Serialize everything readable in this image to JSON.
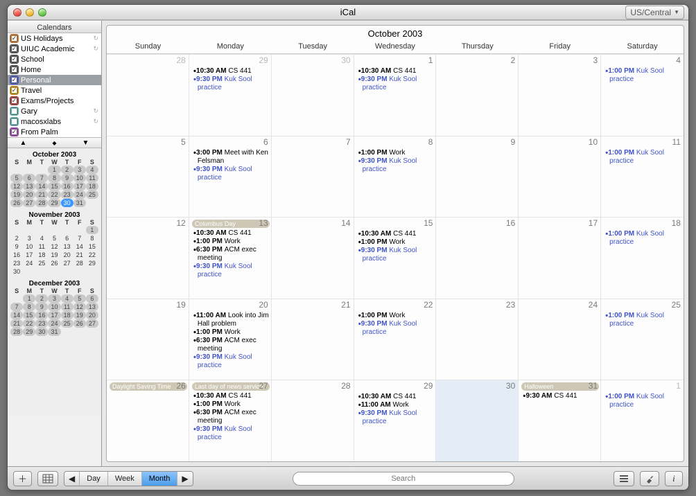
{
  "window": {
    "title": "iCal",
    "timezone": "US/Central"
  },
  "sidebar": {
    "header": "Calendars",
    "items": [
      {
        "label": "US Holidays",
        "color": "#d97a2a",
        "checked": true,
        "shared": true
      },
      {
        "label": "UIUC Academic",
        "color": "#404040",
        "checked": true,
        "shared": true
      },
      {
        "label": "School",
        "color": "#404040",
        "checked": true,
        "shared": false
      },
      {
        "label": "Home",
        "color": "#404040",
        "checked": true,
        "shared": false
      },
      {
        "label": "Personal",
        "color": "#4053c8",
        "checked": true,
        "shared": false,
        "selected": true
      },
      {
        "label": "Travel",
        "color": "#e2a100",
        "checked": true,
        "shared": false
      },
      {
        "label": "Exams/Projects",
        "color": "#b02727",
        "checked": true,
        "shared": false
      },
      {
        "label": "Gary",
        "color": "#69c0c0",
        "checked": false,
        "shared": true
      },
      {
        "label": "macosxlabs",
        "color": "#69c0c0",
        "checked": false,
        "shared": true
      },
      {
        "label": "From Palm",
        "color": "#9c3bb0",
        "checked": true,
        "shared": false
      }
    ]
  },
  "minicals": {
    "dow": [
      "S",
      "M",
      "T",
      "W",
      "T",
      "F",
      "S"
    ],
    "months": [
      {
        "caption": "October 2003",
        "start": 3,
        "days": 31,
        "allPill": true,
        "highlight": 30
      },
      {
        "caption": "November 2003",
        "start": 6,
        "days": 30,
        "pillDays": [
          1
        ],
        "highlight": null
      },
      {
        "caption": "December 2003",
        "start": 1,
        "days": 31,
        "allPill": true,
        "highlight": null
      }
    ]
  },
  "calendar": {
    "title": "October 2003",
    "dow": [
      "Sunday",
      "Monday",
      "Tuesday",
      "Wednesday",
      "Thursday",
      "Friday",
      "Saturday"
    ],
    "weeks": [
      [
        {
          "num": "28",
          "other": true
        },
        {
          "num": "29",
          "other": true,
          "events": [
            {
              "c": "blk",
              "t": "10:30 AM",
              "s": "CS 441"
            },
            {
              "c": "blue",
              "t": "9:30 PM",
              "s": "Kuk Sool practice"
            }
          ]
        },
        {
          "num": "30",
          "other": true
        },
        {
          "num": "1",
          "events": [
            {
              "c": "blk",
              "t": "10:30 AM",
              "s": "CS 441"
            },
            {
              "c": "blue",
              "t": "9:30 PM",
              "s": "Kuk Sool practice"
            }
          ]
        },
        {
          "num": "2"
        },
        {
          "num": "3"
        },
        {
          "num": "4",
          "events": [
            {
              "c": "blue",
              "t": "1:00 PM",
              "s": "Kuk Sool practice"
            }
          ]
        }
      ],
      [
        {
          "num": "5"
        },
        {
          "num": "6",
          "events": [
            {
              "c": "blk",
              "t": "3:00 PM",
              "s": "Meet with Ken Felsman"
            },
            {
              "c": "blue",
              "t": "9:30 PM",
              "s": "Kuk Sool practice"
            }
          ]
        },
        {
          "num": "7"
        },
        {
          "num": "8",
          "events": [
            {
              "c": "blk",
              "t": "1:00 PM",
              "s": "Work"
            },
            {
              "c": "blue",
              "t": "9:30 PM",
              "s": "Kuk Sool practice"
            }
          ]
        },
        {
          "num": "9"
        },
        {
          "num": "10"
        },
        {
          "num": "11",
          "events": [
            {
              "c": "blue",
              "t": "1:00 PM",
              "s": "Kuk Sool practice"
            }
          ]
        }
      ],
      [
        {
          "num": "12"
        },
        {
          "num": "13",
          "banner": "Columbus Day",
          "events": [
            {
              "c": "blk",
              "t": "10:30 AM",
              "s": "CS 441"
            },
            {
              "c": "blk",
              "t": "1:00 PM",
              "s": "Work"
            },
            {
              "c": "blk",
              "t": "6:30 PM",
              "s": "ACM exec meeting"
            },
            {
              "c": "blue",
              "t": "9:30 PM",
              "s": "Kuk Sool practice"
            }
          ]
        },
        {
          "num": "14"
        },
        {
          "num": "15",
          "events": [
            {
              "c": "blk",
              "t": "10:30 AM",
              "s": "CS 441"
            },
            {
              "c": "blk",
              "t": "1:00 PM",
              "s": "Work"
            },
            {
              "c": "blue",
              "t": "9:30 PM",
              "s": "Kuk Sool practice"
            }
          ]
        },
        {
          "num": "16"
        },
        {
          "num": "17"
        },
        {
          "num": "18",
          "events": [
            {
              "c": "blue",
              "t": "1:00 PM",
              "s": "Kuk Sool practice"
            }
          ]
        }
      ],
      [
        {
          "num": "19"
        },
        {
          "num": "20",
          "events": [
            {
              "c": "blk",
              "t": "11:00 AM",
              "s": "Look into Jim Hall problem"
            },
            {
              "c": "blk",
              "t": "1:00 PM",
              "s": "Work"
            },
            {
              "c": "blk",
              "t": "6:30 PM",
              "s": "ACM exec meeting"
            },
            {
              "c": "blue",
              "t": "9:30 PM",
              "s": "Kuk Sool practice"
            }
          ]
        },
        {
          "num": "21"
        },
        {
          "num": "22",
          "events": [
            {
              "c": "blk",
              "t": "1:00 PM",
              "s": "Work"
            },
            {
              "c": "blue",
              "t": "9:30 PM",
              "s": "Kuk Sool practice"
            }
          ]
        },
        {
          "num": "23"
        },
        {
          "num": "24"
        },
        {
          "num": "25",
          "events": [
            {
              "c": "blue",
              "t": "1:00 PM",
              "s": "Kuk Sool practice"
            }
          ]
        }
      ],
      [
        {
          "num": "26",
          "banner": "Daylight Saving Time"
        },
        {
          "num": "27",
          "banner": "Last day of news service",
          "events": [
            {
              "c": "blk",
              "t": "10:30 AM",
              "s": "CS 441"
            },
            {
              "c": "blk",
              "t": "1:00 PM",
              "s": "Work"
            },
            {
              "c": "blk",
              "t": "6:30 PM",
              "s": "ACM exec meeting"
            },
            {
              "c": "blue",
              "t": "9:30 PM",
              "s": "Kuk Sool practice"
            }
          ]
        },
        {
          "num": "28"
        },
        {
          "num": "29",
          "events": [
            {
              "c": "blk",
              "t": "10:30 AM",
              "s": "CS 441"
            },
            {
              "c": "blk",
              "t": "11:00 AM",
              "s": "Work"
            },
            {
              "c": "blue",
              "t": "9:30 PM",
              "s": "Kuk Sool practice"
            }
          ]
        },
        {
          "num": "30",
          "today": true
        },
        {
          "num": "31",
          "banner": "Halloween",
          "events": [
            {
              "c": "blk",
              "t": "9:30 AM",
              "s": "CS 441"
            }
          ]
        },
        {
          "num": "1",
          "other": true,
          "events": [
            {
              "c": "blue",
              "t": "1:00 PM",
              "s": "Kuk Sool practice"
            }
          ]
        }
      ]
    ]
  },
  "toolbar": {
    "views": [
      "Day",
      "Week",
      "Month"
    ],
    "active_view": "Month",
    "search_placeholder": "Search"
  }
}
